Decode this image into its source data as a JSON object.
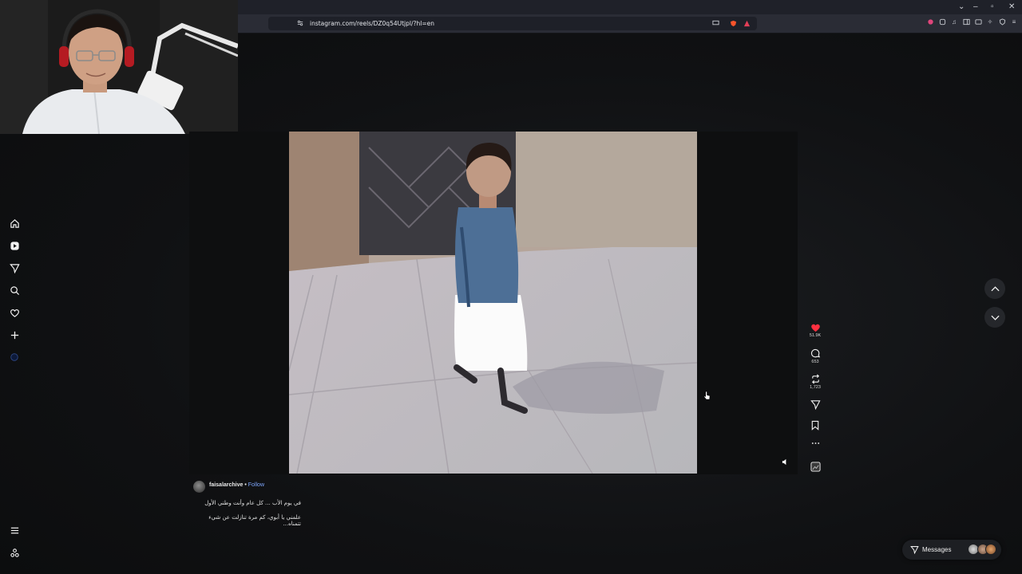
{
  "browser": {
    "url": "instagram.com/reels/DZ0q54Utjpl/?hl=en",
    "window_controls": [
      "–",
      "▫",
      "✕"
    ],
    "chevron": "⌄"
  },
  "nav": {
    "items": [
      "home-icon",
      "reels-icon",
      "direct-icon",
      "search-icon",
      "heart-icon",
      "create-icon",
      "profile-icon"
    ],
    "bottom": [
      "menu-icon",
      "more-icon"
    ]
  },
  "reel": {
    "actions": {
      "likes": "51.9K",
      "comments": "653",
      "reposts": "1,723"
    },
    "author": "faisalarchive",
    "separator": "•",
    "follow_label": "Follow",
    "caption_line1": "في يوم الأب ... كل عام وأنت وطني الأول",
    "caption_line2": "علمني يا أبوي، كم مرة تنازلت عن شيء تتمناه..."
  },
  "messages": {
    "label": "Messages"
  },
  "colors": {
    "accent_like": "#ff3040",
    "link": "#7fa8ff"
  }
}
